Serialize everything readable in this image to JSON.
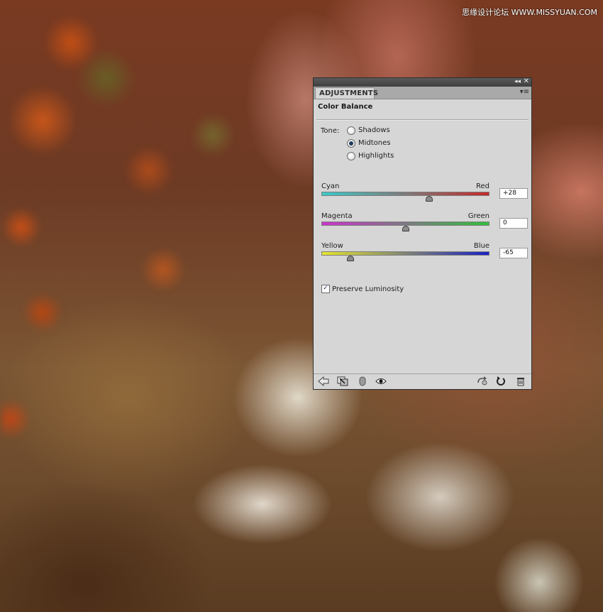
{
  "watermark": "思缘设计论坛 WWW.MISSYUAN.COM",
  "panel": {
    "tab_label": "ADJUSTMENTS",
    "heading": "Color Balance",
    "tone": {
      "label": "Tone:",
      "options": [
        {
          "label": "Shadows",
          "selected": false
        },
        {
          "label": "Midtones",
          "selected": true
        },
        {
          "label": "Highlights",
          "selected": false
        }
      ]
    },
    "sliders": [
      {
        "left_label": "Cyan",
        "right_label": "Red",
        "value": "+28",
        "numeric": 28,
        "gradient": [
          "#3ac9c9",
          "#c42a2a"
        ]
      },
      {
        "left_label": "Magenta",
        "right_label": "Green",
        "value": "0",
        "numeric": 0,
        "gradient": [
          "#cc33cc",
          "#2fbf3b"
        ]
      },
      {
        "left_label": "Yellow",
        "right_label": "Blue",
        "value": "-65",
        "numeric": -65,
        "gradient": [
          "#e6e62a",
          "#1a22c4"
        ]
      }
    ],
    "slider_range": [
      -100,
      100
    ],
    "preserve_luminosity": {
      "label": "Preserve Luminosity",
      "checked": true
    },
    "bottom_icons": [
      "back-arrow-icon",
      "clip-to-layer-icon",
      "visibility-toggle-icon",
      "eye-icon",
      "view-previous-icon",
      "reset-icon",
      "trash-icon"
    ]
  }
}
